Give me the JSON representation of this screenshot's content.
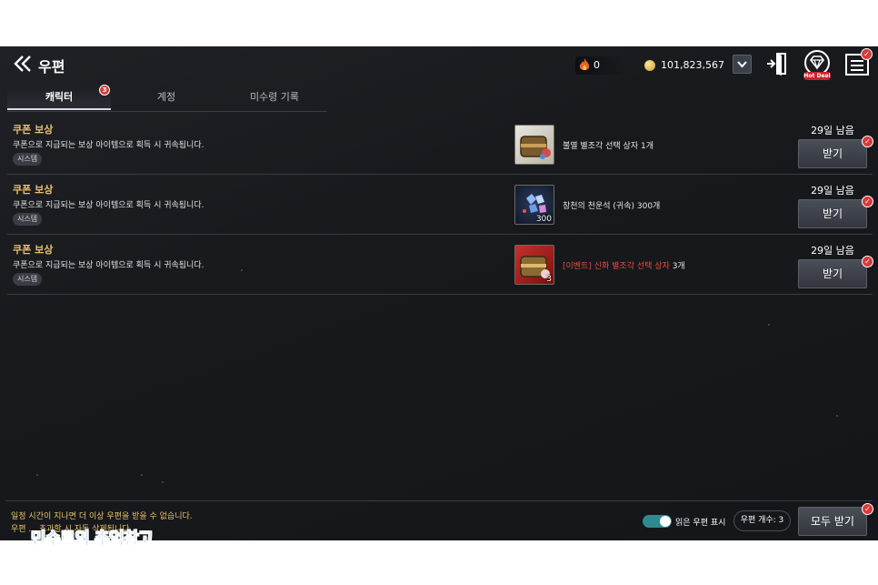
{
  "header": {
    "title": "우편",
    "fire_value": "0",
    "gold_value": "101,823,567",
    "hot_deal_label": "Hot Deal",
    "menu_badge_count": "5"
  },
  "tabs": [
    {
      "label": "캐릭터",
      "badge": "3",
      "active": true
    },
    {
      "label": "계정",
      "active": false
    },
    {
      "label": "미수령 기록",
      "active": false
    }
  ],
  "mails": [
    {
      "title": "쿠폰 보상",
      "description": "쿠폰으로 지급되는 보상 아이템으로 획득 시 귀속됩니다.",
      "tag": "시스템",
      "item_name": "불멸 별조각 선택 상자",
      "item_qty": "1개",
      "item_count_overlay": "",
      "expiry": "29일 남음",
      "button": "받기"
    },
    {
      "title": "쿠폰 보상",
      "description": "쿠폰으로 지급되는 보상 아이템으로 획득 시 귀속됩니다.",
      "tag": "시스템",
      "item_name": "창천의 천운석 (귀속)",
      "item_qty": "300개",
      "item_count_overlay": "300",
      "expiry": "29일 남음",
      "button": "받기"
    },
    {
      "title": "쿠폰 보상",
      "description": "쿠폰으로 지급되는 보상 아이템으로 획득 시 귀속됩니다.",
      "tag": "시스템",
      "item_name": "[이벤트] 신화 별조각 선택 상자",
      "item_qty": "3개",
      "item_count_overlay": "3",
      "expiry": "29일 남음",
      "button": "받기"
    }
  ],
  "footer": {
    "note_line1": "일정 시간이 지나면 더 이상 우편을 받을 수 없습니다.",
    "note_line2": "우편 ... 초과할 시 자동 삭제됩니다.",
    "toggle_label": "읽은 우편 표시",
    "toggle_on": true,
    "mail_count": "우편 개수: 3",
    "receive_all": "모두 받기"
  },
  "watermark": "민수르의 추억창고",
  "colors": {
    "accent_gold": "#e9c46a",
    "badge_red": "#d83a3a",
    "toggle_teal": "#2f8a8f",
    "event_red": "#e0503c"
  }
}
